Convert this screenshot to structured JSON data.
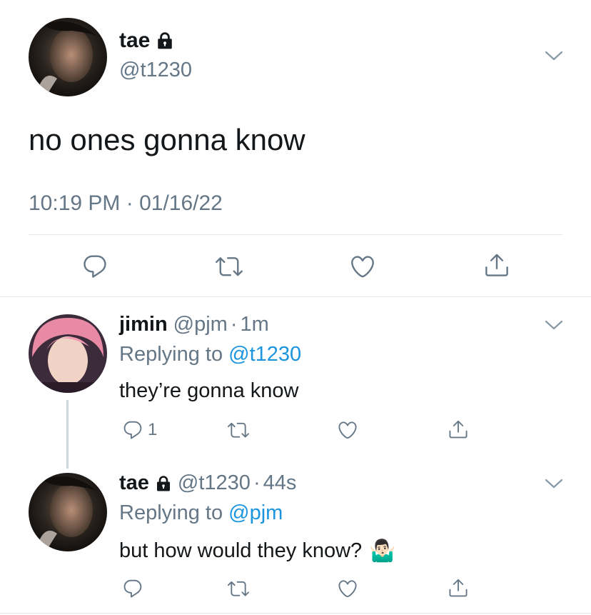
{
  "main_tweet": {
    "name": "tae",
    "handle": "@t1230",
    "text": "no ones gonna know",
    "timestamp": "10:19 PM · 01/16/22",
    "avatar": "dark-portrait-avatar",
    "locked_icon": "lock-icon"
  },
  "replies": [
    {
      "name": "jimin",
      "handle": "@pjm",
      "separator": "·",
      "time": "1m",
      "replying_prefix": "Replying to ",
      "replying_to": "@t1230",
      "text": "they’re gonna know",
      "reply_count": "1",
      "avatar": "pink-hair-avatar"
    },
    {
      "name": "tae",
      "handle": "@t1230",
      "separator": "·",
      "time": "44s",
      "replying_prefix": "Replying to ",
      "replying_to": "@pjm",
      "text": "but how would they know?",
      "emoji": "🤷🏻‍♂️",
      "avatar": "dark-portrait-avatar"
    }
  ],
  "icons": [
    "reply-icon",
    "retweet-icon",
    "like-icon",
    "share-icon",
    "chevron-down-icon",
    "lock-icon"
  ],
  "colors": {
    "link": "#1b95e0",
    "muted": "#657786",
    "text": "#14171a",
    "divider": "#e1e8ed"
  }
}
